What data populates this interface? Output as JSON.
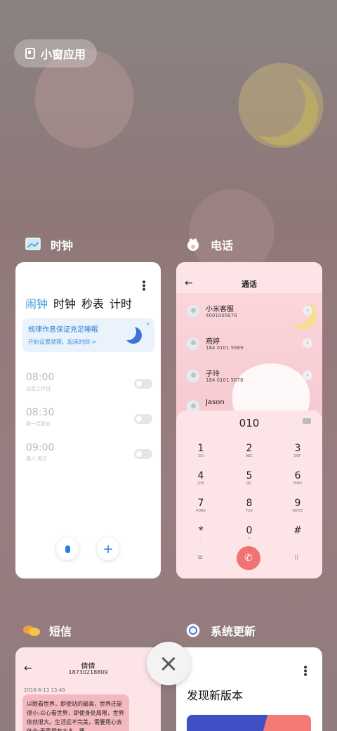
{
  "floating_window_button": {
    "label": "小窗应用"
  },
  "apps": {
    "clock": {
      "name": "时钟",
      "tabs": [
        "闹钟",
        "时钟",
        "秒表",
        "计时"
      ],
      "banner": {
        "title": "规律作息保证充足睡眠",
        "subtitle": "开始设置就寝、起床时间 >",
        "close": "×"
      },
      "alarms": [
        {
          "time": "08:00",
          "repeat": "法定工作日",
          "enabled": false
        },
        {
          "time": "08:30",
          "repeat": "周一至周五",
          "enabled": false
        },
        {
          "time": "09:00",
          "repeat": "周六 周日",
          "enabled": false
        }
      ],
      "add_button": "+"
    },
    "phone": {
      "name": "电话",
      "title": "通话",
      "back": "←",
      "contacts": [
        {
          "name": "小米客服",
          "number": "4001005678"
        },
        {
          "name": "燕婷",
          "number": "184 0101 5689"
        },
        {
          "name": "子玲",
          "number": "184 0101 5678"
        },
        {
          "name": "Jason",
          "number": ""
        }
      ],
      "dialed": "010",
      "keys": [
        {
          "n": "1",
          "l": "GO"
        },
        {
          "n": "2",
          "l": "ABC"
        },
        {
          "n": "3",
          "l": "DEF"
        },
        {
          "n": "4",
          "l": "GHI"
        },
        {
          "n": "5",
          "l": "JKL"
        },
        {
          "n": "6",
          "l": "MNO"
        },
        {
          "n": "7",
          "l": "PQRS"
        },
        {
          "n": "8",
          "l": "TUV"
        },
        {
          "n": "9",
          "l": "WXYZ"
        },
        {
          "n": "*",
          "l": ","
        },
        {
          "n": "0",
          "l": "+"
        },
        {
          "n": "#",
          "l": ""
        }
      ],
      "menu_glyph": "≡",
      "keypad_glyph": "⁞⁞",
      "call_glyph": "✆"
    },
    "sms": {
      "name": "短信",
      "back": "←",
      "contact_name": "倩倩",
      "contact_number": "18730218809",
      "date": "2016-6-13 13:49",
      "message": "以眼看世界，即使站的最高，世界还是很小;以心看世界，即使身处局限，世界依然很大。生活远不完美，需要用心去体会;无需拥有太多，要"
    },
    "update": {
      "name": "系统更新",
      "title": "发现新版本"
    }
  },
  "close_all": "×",
  "colors": {
    "accent_blue": "#3a9be0",
    "call_red": "#f07272",
    "phone_bg": "#fde4e7"
  }
}
